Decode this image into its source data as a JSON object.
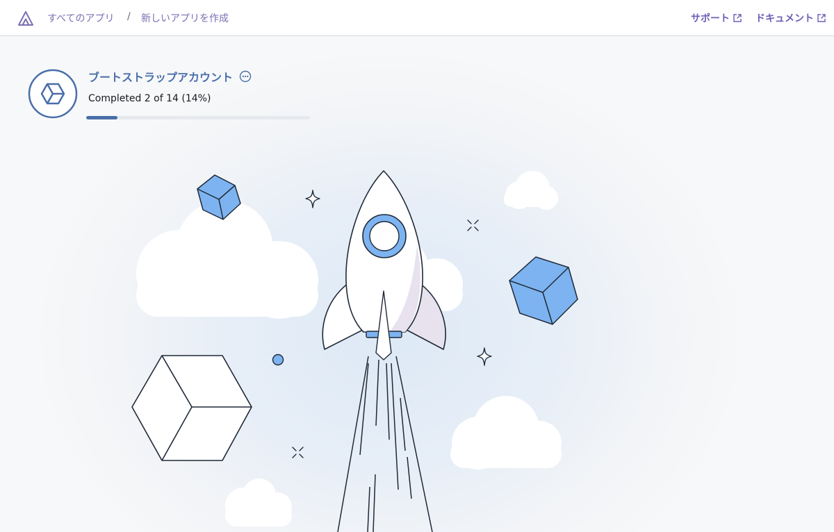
{
  "header": {
    "breadcrumb": [
      {
        "label": "すべてのアプリ"
      },
      {
        "label": "新しいアプリを作成"
      }
    ],
    "separator": "/",
    "links": {
      "support": "サポート",
      "docs": "ドキュメント"
    }
  },
  "step": {
    "title": "ブートストラップアカウント",
    "progress_text": "Completed 2 of 14 (14%)",
    "completed": 2,
    "total": 14,
    "percent": 14
  },
  "icons": {
    "logo": "amplify-logo-icon",
    "external": "external-link-icon",
    "more": "ellipsis-circle-icon",
    "step": "cube-icon"
  },
  "colors": {
    "accent": "#4a6ea9",
    "link": "#6b5fb5",
    "cube_blue": "#7db3f0"
  }
}
